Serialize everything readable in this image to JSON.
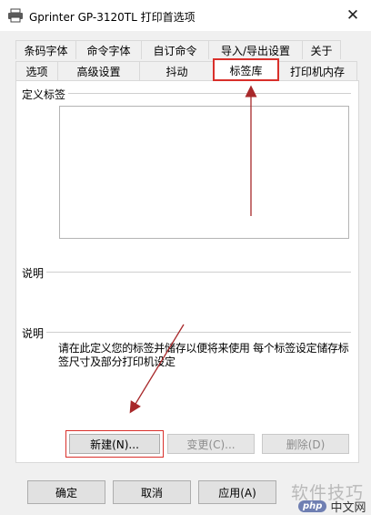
{
  "window": {
    "title": "Gprinter  GP-3120TL 打印首选项",
    "close_glyph": "✕"
  },
  "tabs": {
    "back_row": [
      "条码字体",
      "命令字体",
      "自订命令",
      "导入/导出设置",
      "关于"
    ],
    "front_row": [
      "选项",
      "高级设置",
      "抖动",
      "标签库",
      "打印机内存"
    ],
    "active": "标签库"
  },
  "panel": {
    "group_custom_labels": "定义标签",
    "group_desc1": "说明",
    "group_desc2": "说明",
    "description": "请在此定义您的标签并储存以便将来使用 每个标签设定储存标签尺寸及部分打印机设定",
    "buttons": {
      "new": "新建(N)...",
      "modify": "变更(C)...",
      "delete": "删除(D)"
    }
  },
  "footer": {
    "ok": "确定",
    "cancel": "取消",
    "apply": "应用(A)"
  },
  "watermark": {
    "main": "软件技巧",
    "php": "php",
    "cn": "中文网"
  },
  "colors": {
    "highlight": "#d9302b",
    "arrow": "#a8282a"
  }
}
